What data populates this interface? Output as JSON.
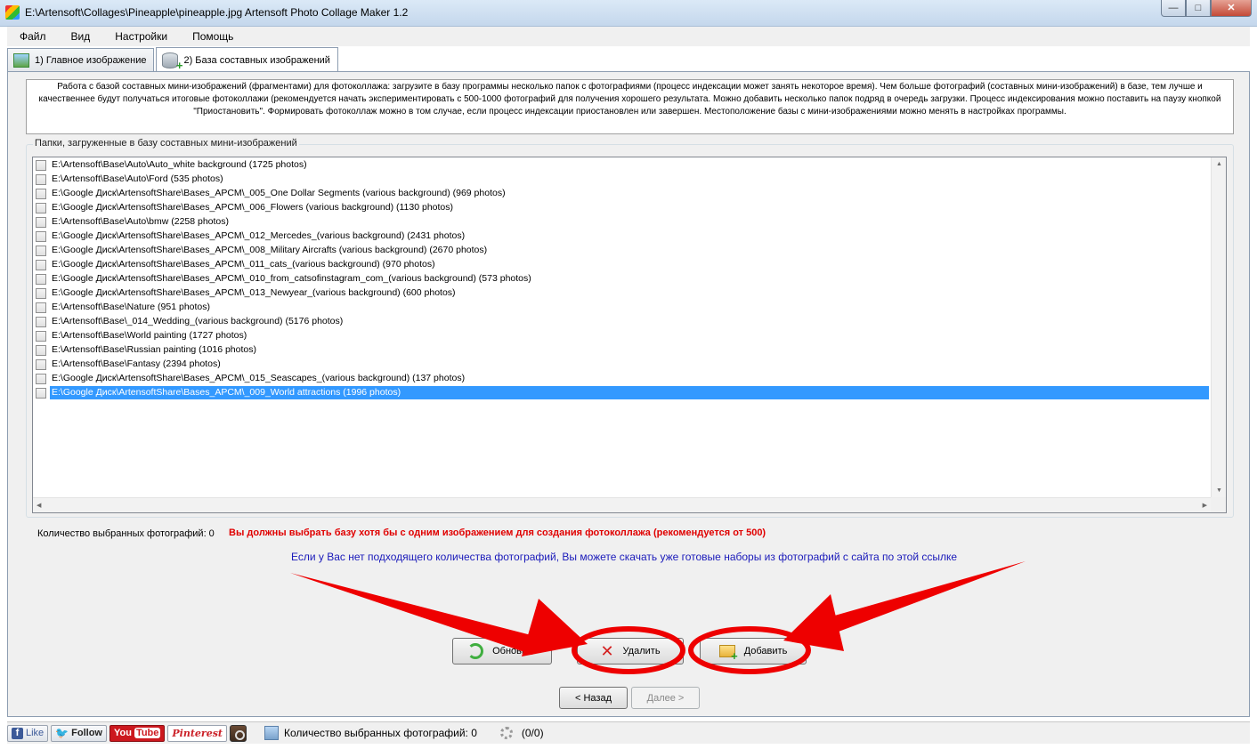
{
  "window": {
    "title": "E:\\Artensoft\\Collages\\Pineapple\\pineapple.jpg Artensoft Photo Collage Maker 1.2",
    "minimize_label": "—",
    "maximize_label": "□",
    "close_label": "✕"
  },
  "menu": {
    "items": [
      "Файл",
      "Вид",
      "Настройки",
      "Помощь"
    ]
  },
  "tabs": [
    {
      "label": "1) Главное изображение",
      "icon": "image-icon"
    },
    {
      "label": "2) База составных изображений",
      "icon": "database-add-icon"
    }
  ],
  "info": {
    "text": "Работа с базой составных мини-изображений (фрагментами) для фотоколлажа: загрузите в базу программы несколько папок с фотографиями (процесс индексации может занять некоторое время). Чем больше фотографий (составных мини-изображений) в базе, тем лучше и качественнее будут получаться итоговые фотоколлажи (рекомендуется начать экспериментировать с 500-1000 фотографий для получения хорошего результата. Можно добавить несколько папок подряд в очередь загрузки. Процесс индексирования можно поставить на паузу кнопкой \"Приостановить\". Формировать фотоколлаж можно в том случае, если процесс индексации приостановлен или завершен. Местоположение базы с мини-изображениями можно менять в настройках программы."
  },
  "folders": {
    "group_label": "Папки, загруженные в базу составных мини-изображений",
    "items": [
      "E:\\Artensoft\\Base\\Auto\\Auto_white background (1725 photos)",
      "E:\\Artensoft\\Base\\Auto\\Ford (535 photos)",
      "E:\\Google Диск\\ArtensoftShare\\Bases_APCM\\_005_One Dollar Segments (various background) (969 photos)",
      "E:\\Google Диск\\ArtensoftShare\\Bases_APCM\\_006_Flowers (various background) (1130 photos)",
      "E:\\Artensoft\\Base\\Auto\\bmw (2258 photos)",
      "E:\\Google Диск\\ArtensoftShare\\Bases_APCM\\_012_Mercedes_(various background) (2431 photos)",
      "E:\\Google Диск\\ArtensoftShare\\Bases_APCM\\_008_Military Aircrafts (various background) (2670 photos)",
      "E:\\Google Диск\\ArtensoftShare\\Bases_APCM\\_011_cats_(various background) (970 photos)",
      "E:\\Google Диск\\ArtensoftShare\\Bases_APCM\\_010_from_catsofinstagram_com_(various background) (573 photos)",
      "E:\\Google Диск\\ArtensoftShare\\Bases_APCM\\_013_Newyear_(various background) (600 photos)",
      "E:\\Artensoft\\Base\\Nature (951 photos)",
      "E:\\Artensoft\\Base\\_014_Wedding_(various background) (5176 photos)",
      "E:\\Artensoft\\Base\\World painting (1727 photos)",
      "E:\\Artensoft\\Base\\Russian painting (1016 photos)",
      "E:\\Artensoft\\Base\\Fantasy (2394 photos)",
      "E:\\Google Диск\\ArtensoftShare\\Bases_APCM\\_015_Seascapes_(various background) (137 photos)",
      "E:\\Google Диск\\ArtensoftShare\\Bases_APCM\\_009_World attractions (1996 photos)"
    ],
    "selected_index": 16
  },
  "summary": {
    "count_label": "Количество выбранных фотографий: 0",
    "warning": "Вы должны выбрать базу хотя бы с одним изображением для создания фотоколлажа (рекомендуется от 500)",
    "link": "Если у Вас нет подходящего количества фотографий, Вы можете скачать уже готовые наборы из фотографий с сайта по этой ссылке"
  },
  "actions": {
    "refresh_label": "Обновить",
    "delete_label": "Удалить",
    "add_label": "Добавить",
    "back_label": "< Назад",
    "next_label": "Далее >"
  },
  "statusbar": {
    "facebook_label": "Like",
    "twitter_label": "Follow",
    "youtube_you": "You",
    "youtube_tube": "Tube",
    "pinterest_label": "Pinterest",
    "photos_count": "Количество выбранных фотографий: 0",
    "progress": "(0/0)"
  },
  "colors": {
    "selection": "#3399ff",
    "warning": "#e00000",
    "link": "#1a1aba",
    "annotation": "#ee0000"
  }
}
